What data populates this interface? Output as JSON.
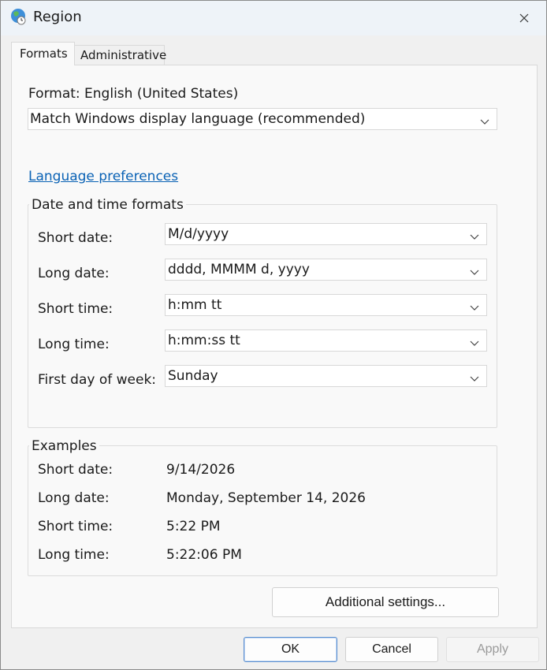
{
  "window": {
    "title": "Region"
  },
  "tabs": [
    {
      "label": "Formats",
      "active": true
    },
    {
      "label": "Administrative",
      "active": false
    }
  ],
  "format": {
    "label": "Format: English (United States)",
    "selected": "Match Windows display language (recommended)"
  },
  "language_link": "Language preferences",
  "date_time_formats": {
    "title": "Date and time formats",
    "rows": [
      {
        "label": "Short date:",
        "value": "M/d/yyyy"
      },
      {
        "label": "Long date:",
        "value": "dddd, MMMM d, yyyy"
      },
      {
        "label": "Short time:",
        "value": "h:mm tt"
      },
      {
        "label": "Long time:",
        "value": "h:mm:ss tt"
      },
      {
        "label": "First day of week:",
        "value": "Sunday"
      }
    ]
  },
  "examples": {
    "title": "Examples",
    "rows": [
      {
        "label": "Short date:",
        "value": "9/14/2026"
      },
      {
        "label": "Long date:",
        "value": "Monday, September 14, 2026"
      },
      {
        "label": "Short time:",
        "value": "5:22 PM"
      },
      {
        "label": "Long time:",
        "value": "5:22:06 PM"
      }
    ]
  },
  "buttons": {
    "additional_settings": "Additional settings...",
    "ok": "OK",
    "cancel": "Cancel",
    "apply": "Apply"
  },
  "icons": {
    "app": "globe-clock-icon",
    "close": "close-icon",
    "dropdown": "chevron-down-icon"
  },
  "colors": {
    "link": "#0a62b5",
    "ok_border": "#5b8fd0",
    "disabled_text": "#9a9a9a"
  }
}
